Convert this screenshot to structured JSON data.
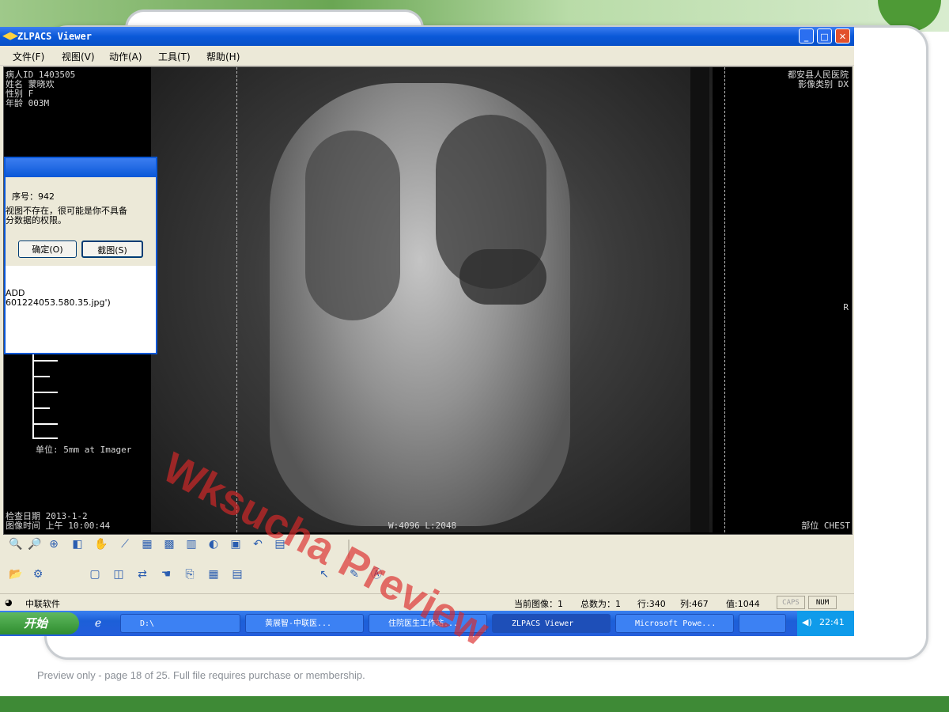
{
  "app": {
    "title": "ZLPACS Viewer",
    "menu": [
      "文件(F)",
      "视图(V)",
      "动作(A)",
      "工具(T)",
      "帮助(H)"
    ]
  },
  "overlay": {
    "top_left": "病人ID 1403505\n姓名 蒙晓欢\n性别 F\n年龄 003M",
    "top_right": "都安县人民医院\n影像类别 DX",
    "bottom_left": "检查日期 2013-1-2\n图像时间 上午 10:00:44",
    "bottom_right": "部位 CHEST",
    "window_level": "W:4096 L:2048",
    "orientation": "R",
    "scale_unit": "单位: 5mm at Imager"
  },
  "dialog": {
    "line1": "序号：942",
    "line2": "视图不存在，很可能是你不具备",
    "line3": "分数据的权限。",
    "ok_button": "确定(O)",
    "capture_button": "截图(S)",
    "detail1": "ADD",
    "detail2": "601224053.580.35.jpg')"
  },
  "status": {
    "company": "中联软件",
    "current_image": "当前图像：1",
    "total": "总数为：1",
    "row": "行:340",
    "col": "列:467",
    "value": "值:1044",
    "caps": "CAPS",
    "num": "NUM"
  },
  "taskbar": {
    "start": "开始",
    "items": [
      "D:\\",
      "黄展智-中联医...",
      "住院医生工作站...",
      "ZLPACS Viewer",
      "Microsoft Powe..."
    ],
    "clock": "22:41"
  },
  "watermark": "Wksucha Preview",
  "footer": "Preview only - page 18 of 25. Full file requires purchase or membership."
}
